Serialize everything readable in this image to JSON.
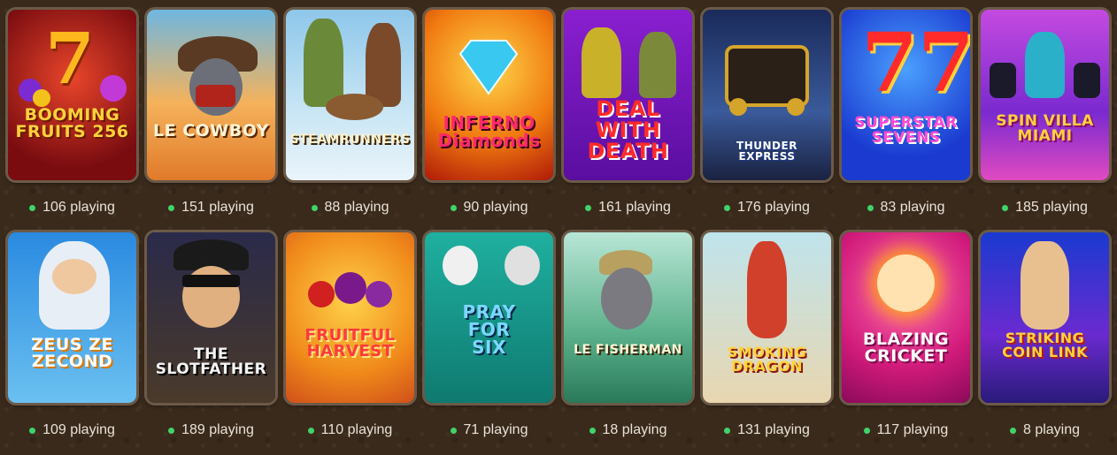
{
  "games": [
    {
      "title": "BOOMING FRUITS 256",
      "players": "106 playing"
    },
    {
      "title": "LE COWBOY",
      "players": "151 playing"
    },
    {
      "title": "STEAMRUNNERS",
      "players": "88 playing"
    },
    {
      "title": "INFERNO Diamonds",
      "players": "90 playing"
    },
    {
      "title": "DEAL WITH DEATH",
      "players": "161 playing"
    },
    {
      "title": "THUNDER EXPRESS",
      "players": "176 playing"
    },
    {
      "title": "SUPERSTAR SEVENS",
      "players": "83 playing"
    },
    {
      "title": "SPIN VILLA MIAMI",
      "players": "185 playing"
    },
    {
      "title": "ZEUS ZE ZECOND",
      "players": "109 playing"
    },
    {
      "title": "THE SLOTFATHER",
      "players": "189 playing"
    },
    {
      "title": "FRUITFUL HARVEST",
      "players": "110 playing"
    },
    {
      "title": "PRAY FOR SIX",
      "players": "71 playing"
    },
    {
      "title": "LE FISHERMAN",
      "players": "18 playing"
    },
    {
      "title": "SMOKING DRAGON",
      "players": "131 playing"
    },
    {
      "title": "BLAZING CRICKET",
      "players": "117 playing"
    },
    {
      "title": "STRIKING COIN LINK",
      "players": "8 playing"
    }
  ],
  "colors": {
    "status_dot": "#3ed46a",
    "text": "#e8e2d8",
    "background": "#3a2a1c"
  }
}
